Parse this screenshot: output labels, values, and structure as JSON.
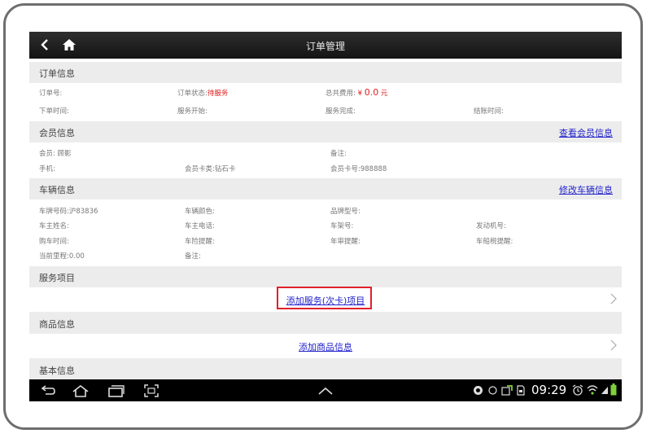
{
  "header": {
    "title": "订单管理"
  },
  "order": {
    "section_title": "订单信息",
    "order_no_label": "订单号:",
    "status_label": "订单状态:",
    "status_value": "待服务",
    "total_label": "总共费用:",
    "total_currency": "¥",
    "total_value": "0.0",
    "total_unit": "元",
    "order_time_label": "下单时间:",
    "service_start_label": "服务开始:",
    "service_done_label": "服务完成:",
    "settle_time_label": "结账时间:"
  },
  "member": {
    "section_title": "会员信息",
    "view_link": "查看会员信息",
    "member": "会员: 顾影",
    "remark": "备注:",
    "phone": "手机:",
    "card_type": "会员卡类:钻石卡",
    "card_no": "会员卡号:988888"
  },
  "vehicle": {
    "section_title": "车辆信息",
    "edit_link": "修改车辆信息",
    "plate": "车牌号码:沪83836",
    "color": "车辆颜色:",
    "brand": "品牌型号:",
    "owner_name": "车主姓名:",
    "owner_phone": "车主电话:",
    "frame_no": "车架号:",
    "engine_no": "发动机号:",
    "purchase_time": "购车时间:",
    "insurance_remind": "车险提醒:",
    "inspection_remind": "年审提醒:",
    "tax_remind": "车船税提醒:",
    "mileage": "当前里程:0.00",
    "remark": "备注:"
  },
  "service": {
    "section_title": "服务项目",
    "add_link": "添加服务(次卡)项目"
  },
  "goods": {
    "section_title": "商品信息",
    "add_link": "添加商品信息"
  },
  "basic": {
    "section_title": "基本信息"
  },
  "statusbar": {
    "time": "09:29"
  },
  "icons": {
    "back": "back-arrow-icon",
    "home": "home-icon",
    "chevron": "chevron-right-icon",
    "nav_back": "nav-back-icon",
    "nav_home": "nav-home-icon",
    "nav_recent": "nav-recent-apps-icon",
    "nav_screenshot": "screenshot-icon",
    "nav_up": "chevron-up-icon"
  },
  "colors": {
    "link": "#2222cc",
    "status": "#e02020",
    "highlight": "#e0202a"
  }
}
